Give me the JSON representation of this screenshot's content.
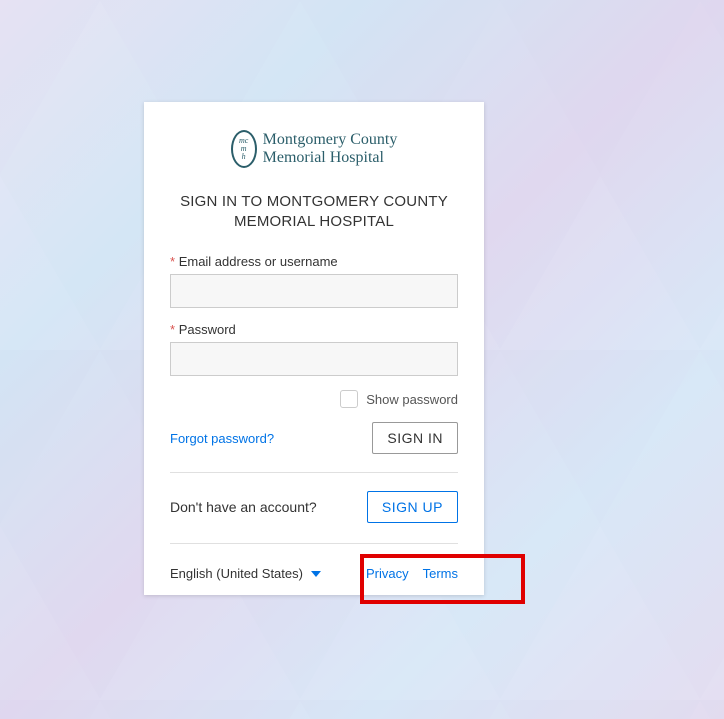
{
  "logo": {
    "line1": "Montgomery County",
    "line2": "Memorial Hospital",
    "oval_top": "mc",
    "oval_mid": "m",
    "oval_bot": "h"
  },
  "heading": "SIGN IN TO MONTGOMERY COUNTY MEMORIAL HOSPITAL",
  "fields": {
    "email_label": "Email address or username",
    "password_label": "Password",
    "required_mark": "*",
    "show_password": "Show password"
  },
  "actions": {
    "forgot": "Forgot password?",
    "signin": "SIGN IN",
    "no_account": "Don't have an account?",
    "signup": "SIGN UP"
  },
  "footer": {
    "language": "English (United States)",
    "privacy": "Privacy",
    "terms": "Terms"
  }
}
